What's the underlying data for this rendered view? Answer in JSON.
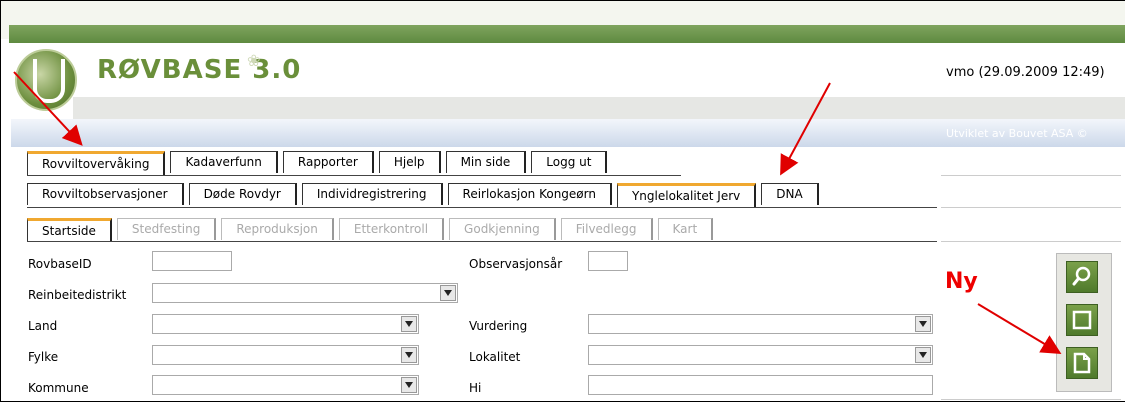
{
  "app": {
    "brand": "RØVBASE 3.0",
    "user_info": "vmo (29.09.2009 12:49)",
    "credit": "Utviklet av Bouvet ASA ©"
  },
  "main_tabs": [
    {
      "label": "Rovviltovervåking",
      "active": true
    },
    {
      "label": "Kadaverfunn"
    },
    {
      "label": "Rapporter"
    },
    {
      "label": "Hjelp"
    },
    {
      "label": "Min side"
    },
    {
      "label": "Logg ut"
    }
  ],
  "sub_tabs": [
    {
      "label": "Rovviltobservasjoner"
    },
    {
      "label": "Døde Rovdyr"
    },
    {
      "label": "Individregistrering"
    },
    {
      "label": "Reirlokasjon Kongeørn"
    },
    {
      "label": "Ynglelokalitet Jerv",
      "active": true
    },
    {
      "label": "DNA"
    }
  ],
  "step_tabs": [
    {
      "label": "Startside",
      "active": true
    },
    {
      "label": "Stedfesting"
    },
    {
      "label": "Reproduksjon"
    },
    {
      "label": "Etterkontroll"
    },
    {
      "label": "Godkjenning"
    },
    {
      "label": "Filvedlegg"
    },
    {
      "label": "Kart"
    }
  ],
  "form": {
    "rovbaseid": {
      "label": "RovbaseID",
      "value": ""
    },
    "observasjonsar": {
      "label": "Observasjonsår",
      "value": ""
    },
    "reinbeitedistrikt": {
      "label": "Reinbeitedistrikt",
      "value": ""
    },
    "land": {
      "label": "Land",
      "value": ""
    },
    "vurdering": {
      "label": "Vurdering",
      "value": ""
    },
    "fylke": {
      "label": "Fylke",
      "value": ""
    },
    "lokalitet": {
      "label": "Lokalitet",
      "value": ""
    },
    "kommune": {
      "label": "Kommune",
      "value": ""
    },
    "hi": {
      "label": "Hi",
      "value": ""
    }
  },
  "annotation": {
    "ny_label": "Ny",
    "arrow_color": "#e00000"
  },
  "colors": {
    "brand_green": "#6a8f3a",
    "active_tab_accent": "#f0a830"
  }
}
